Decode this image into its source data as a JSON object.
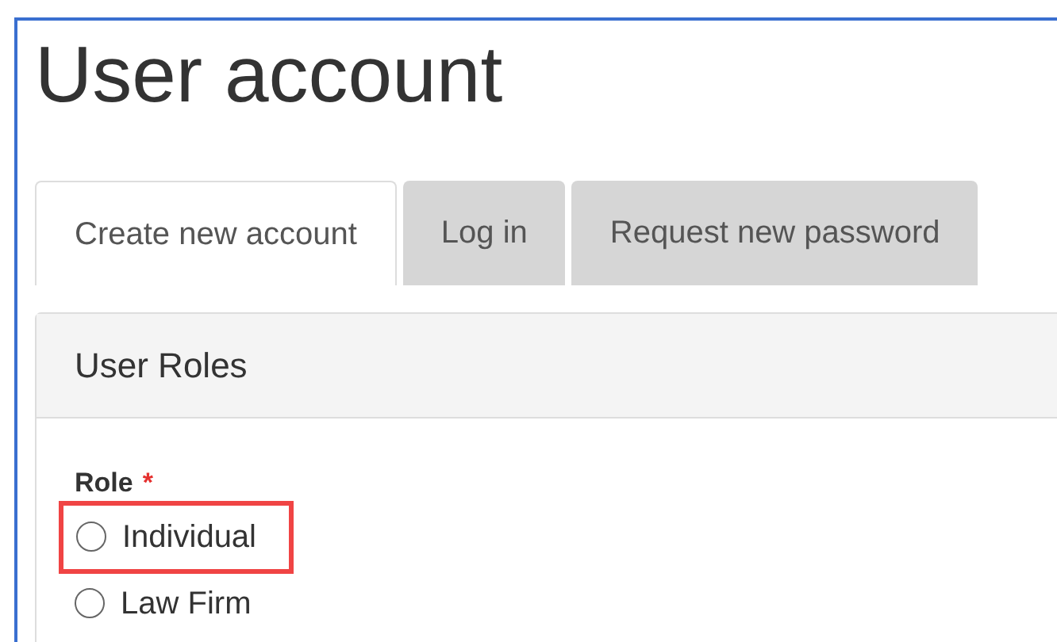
{
  "title": "User account",
  "tabs": [
    {
      "label": "Create new account",
      "selected": true
    },
    {
      "label": "Log in",
      "selected": false
    },
    {
      "label": "Request new password",
      "selected": false
    }
  ],
  "panel": {
    "title": "User Roles",
    "field": {
      "label": "Role",
      "required_mark": "*",
      "options": [
        {
          "label": "Individual",
          "selected": false,
          "highlighted": true
        },
        {
          "label": "Law Firm",
          "selected": false,
          "highlighted": false
        }
      ]
    }
  }
}
